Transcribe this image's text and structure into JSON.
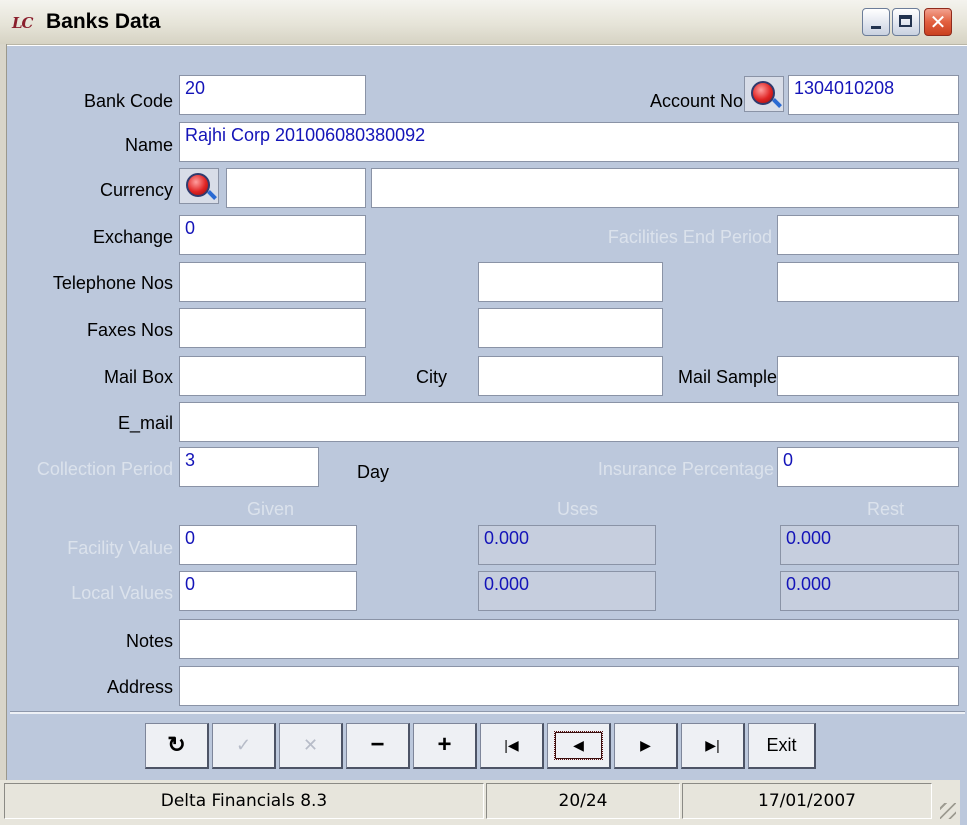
{
  "window": {
    "title": "Banks Data",
    "icon": "lc-app-icon",
    "icon_text": "LC"
  },
  "labels": {
    "bank_code": "Bank Code",
    "account_no": "Account No",
    "name": "Name",
    "currency": "Currency",
    "exchange": "Exchange",
    "facilities_end_period": "Facilities End Period",
    "telephone_nos": "Telephone Nos",
    "faxes_nos": "Faxes Nos",
    "mail_box": "Mail Box",
    "city": "City",
    "mail_sample": "Mail Sample",
    "email": "E_mail",
    "collection_period": "Collection Period",
    "day": "Day",
    "insurance_percentage": "Insurance Percentage",
    "given": "Given",
    "uses": "Uses",
    "rest": "Rest",
    "facility_value": "Facility Value",
    "local_values": "Local Values",
    "notes": "Notes",
    "address": "Address"
  },
  "fields": {
    "bank_code": "20",
    "account_no": "1304010208",
    "name": "Rajhi Corp 201006080380092",
    "currency_code": "",
    "currency_name": "",
    "exchange": "0",
    "facilities_end_period": "",
    "telephone_1": "",
    "telephone_2": "",
    "telephone_3": "",
    "fax_1": "",
    "fax_2": "",
    "mail_box": "",
    "city": "",
    "mail_sample": "",
    "email": "",
    "collection_period": "3",
    "insurance_percentage": "0",
    "facility_given": "0",
    "facility_uses": "0.000",
    "facility_rest": "0.000",
    "local_given": "0",
    "local_uses": "0.000",
    "local_rest": "0.000",
    "notes": "",
    "address": ""
  },
  "toolbar": {
    "refresh": "↻",
    "save": "✓",
    "cancel": "✕",
    "delete": "−",
    "add": "+",
    "first": "|◀",
    "previous": "◀",
    "next": "▶",
    "last": "▶|",
    "exit": "Exit"
  },
  "status": {
    "app": "Delta Financials 8.3",
    "record": "20/24",
    "date": "17/01/2007"
  },
  "colors": {
    "client_bg": "#bcc8dc",
    "field_text": "#1414b8",
    "disabled_label": "#dbe2ec"
  }
}
